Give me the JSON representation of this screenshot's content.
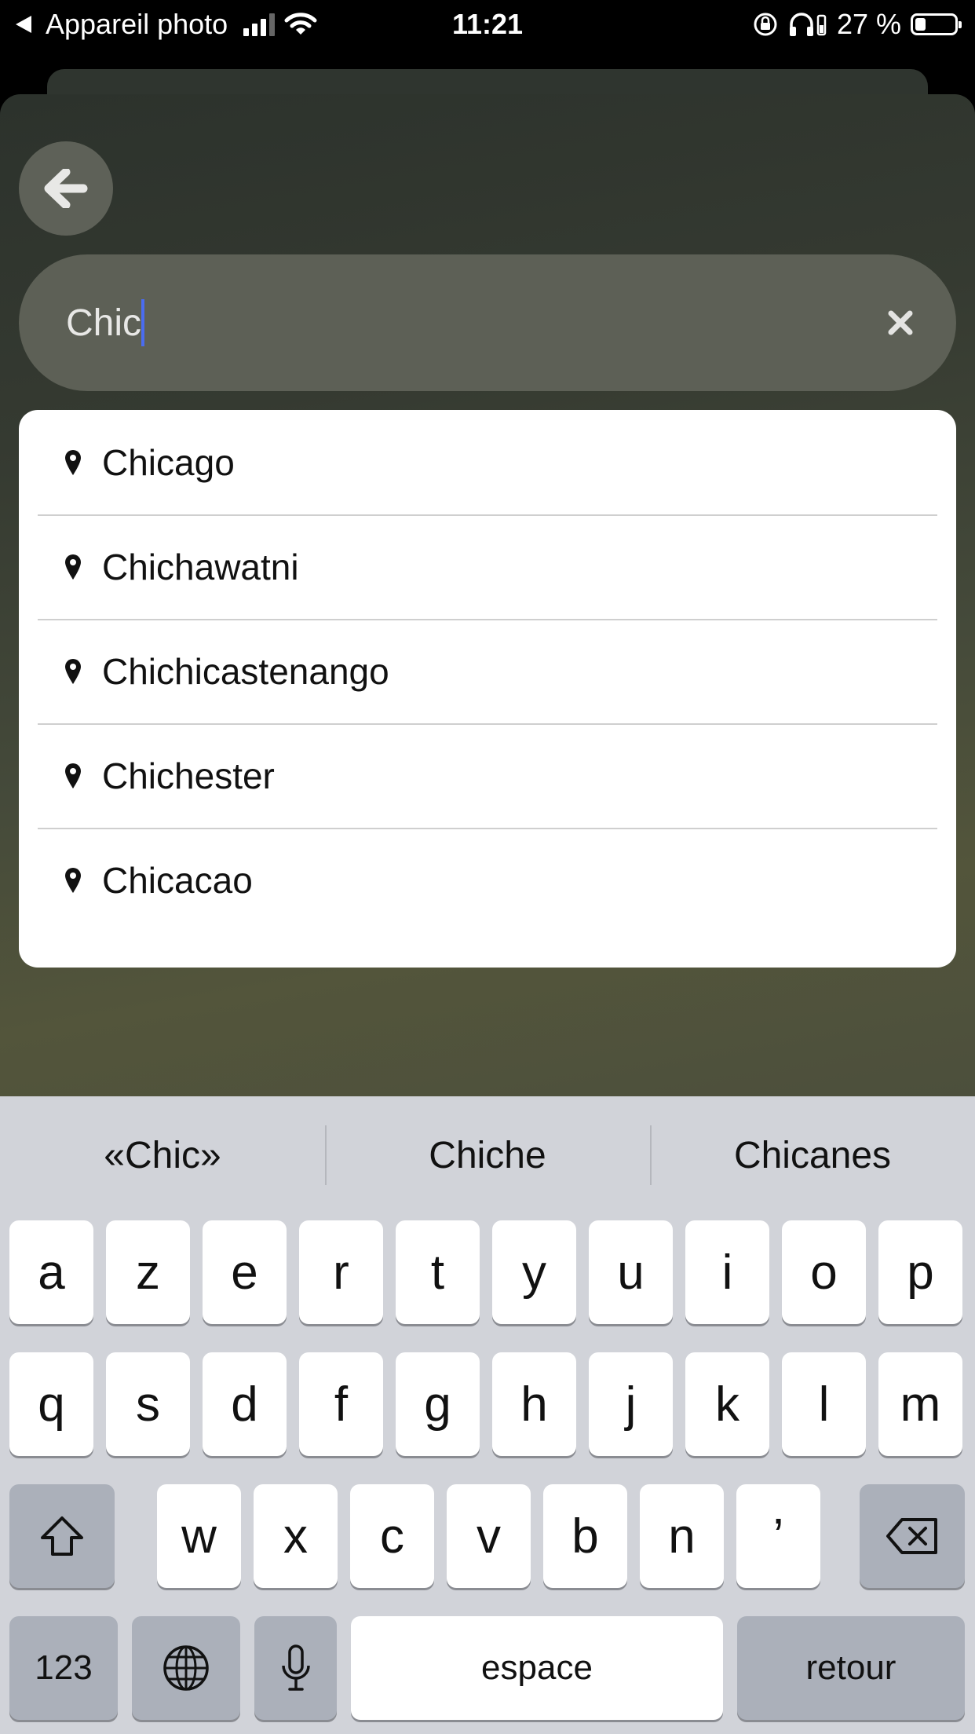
{
  "status_bar": {
    "back_app": "Appareil photo",
    "time": "11:21",
    "battery": "27 %",
    "battery_level": 0.27
  },
  "search": {
    "value": "Chic"
  },
  "results": [
    {
      "label": "Chicago"
    },
    {
      "label": "Chichawatni"
    },
    {
      "label": "Chichicastenango"
    },
    {
      "label": "Chichester"
    },
    {
      "label": "Chicacao"
    }
  ],
  "keyboard": {
    "suggestions": [
      "«Chic»",
      "Chiche",
      "Chicanes"
    ],
    "row1": [
      "a",
      "z",
      "e",
      "r",
      "t",
      "y",
      "u",
      "i",
      "o",
      "p"
    ],
    "row2": [
      "q",
      "s",
      "d",
      "f",
      "g",
      "h",
      "j",
      "k",
      "l",
      "m"
    ],
    "row3": [
      "w",
      "x",
      "c",
      "v",
      "b",
      "n",
      "’"
    ],
    "numbers_label": "123",
    "space_label": "espace",
    "return_label": "retour"
  },
  "colors": {
    "caret": "#4a6cf0",
    "keyboard_bg": "#d1d3d9",
    "key_dark": "#abb0ba"
  }
}
